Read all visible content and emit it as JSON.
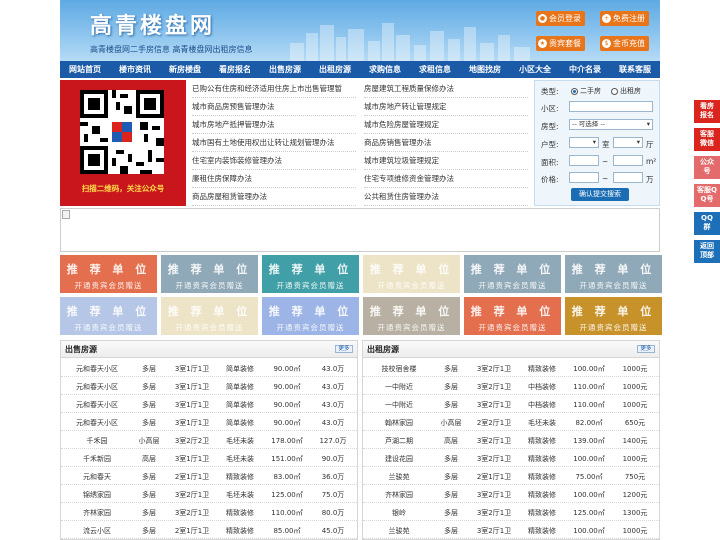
{
  "header": {
    "logo": "高青楼盘网",
    "tagline": "高青楼盘网二手房信息   高青楼盘网出租房信息",
    "buttons": [
      {
        "label": "会员登录",
        "icon": "user-icon"
      },
      {
        "label": "免费注册",
        "icon": "register-icon"
      },
      {
        "label": "贵宾套餐",
        "icon": "vip-icon"
      },
      {
        "label": "金币充值",
        "icon": "coin-icon"
      }
    ]
  },
  "nav": [
    "网站首页",
    "楼市资讯",
    "新房楼盘",
    "看房报名",
    "出售房源",
    "出租房源",
    "求购信息",
    "求租信息",
    "地图找房",
    "小区大全",
    "中介名录",
    "联系客服"
  ],
  "qr": {
    "caption": "扫描二维码，关注公众号"
  },
  "links_left": [
    "已购公有住房和经济适用住房上市出售管理暂",
    "城市商品房预售管理办法",
    "城市房地产抵押管理办法",
    "城市国有土地使用权出让转让规划管理办法",
    "住宅室内装饰装修管理办法",
    "廉租住房保障办法",
    "商品房屋租赁管理办法"
  ],
  "links_right": [
    "房屋建筑工程质量保修办法",
    "城市房地产转让管理规定",
    "城市危险房屋管理规定",
    "商品房销售管理办法",
    "城市建筑垃圾管理规定",
    "住宅专项维修资金管理办法",
    "公共租赁住房管理办法"
  ],
  "search": {
    "type_label": "类型:",
    "type_options": [
      "二手房",
      "出租房"
    ],
    "community_label": "小区:",
    "property_label": "房型:",
    "property_value": "-- 可选择 --",
    "layout_label": "户型:",
    "room_unit": "室",
    "hall_unit": "厅",
    "area_label": "面积:",
    "area_sep": "~",
    "area_unit": "m²",
    "price_label": "价格:",
    "price_sep": "~",
    "price_unit": "万",
    "submit": "确认提交搜索"
  },
  "tiles": {
    "line1": "推 荐 单 位",
    "line2": "开通贵宾会员赠送",
    "colors": [
      "#e46f4f",
      "#90a9b8",
      "#41a0a7",
      "#ede3c6",
      "#90a9b8",
      "#90a9b8",
      "#b5c6e6",
      "#ede3c6",
      "#9db4e6",
      "#b8b0a2",
      "#e46f4f",
      "#c8922b"
    ]
  },
  "sale": {
    "title": "出售房源",
    "more": "更多",
    "rows": [
      [
        "元和春天小区",
        "多层",
        "3室1厅1卫",
        "简单装修",
        "90.00㎡",
        "43.0万"
      ],
      [
        "元和春天小区",
        "多层",
        "3室1厅1卫",
        "简单装修",
        "90.00㎡",
        "43.0万"
      ],
      [
        "元和春天小区",
        "多层",
        "3室1厅1卫",
        "简单装修",
        "90.00㎡",
        "43.0万"
      ],
      [
        "元和春天小区",
        "多层",
        "3室1厅1卫",
        "简单装修",
        "90.00㎡",
        "43.0万"
      ],
      [
        "千禾园",
        "小高层",
        "3室2厅2卫",
        "毛坯未装",
        "178.00㎡",
        "127.0万"
      ],
      [
        "千禾新园",
        "高层",
        "3室1厅1卫",
        "毛坯未装",
        "151.00㎡",
        "90.0万"
      ],
      [
        "元和春天",
        "多层",
        "2室1厅1卫",
        "精致装修",
        "83.00㎡",
        "36.0万"
      ],
      [
        "锦绣家园",
        "多层",
        "3室2厅1卫",
        "毛坯未装",
        "125.00㎡",
        "75.0万"
      ],
      [
        "齐林家园",
        "多层",
        "3室2厅1卫",
        "精致装修",
        "110.00㎡",
        "80.0万"
      ],
      [
        "流云小区",
        "多层",
        "2室1厅1卫",
        "精致装修",
        "85.00㎡",
        "45.0万"
      ]
    ]
  },
  "rent": {
    "title": "出租房源",
    "more": "更多",
    "rows": [
      [
        "技校宿舍楼",
        "多层",
        "3室2厅1卫",
        "精致装修",
        "100.00㎡",
        "1000元"
      ],
      [
        "一中附近",
        "多层",
        "3室2厅1卫",
        "中档装修",
        "110.00㎡",
        "1000元"
      ],
      [
        "一中附近",
        "多层",
        "3室2厅1卫",
        "中档装修",
        "110.00㎡",
        "1000元"
      ],
      [
        "翰林家园",
        "小高层",
        "2室2厅1卫",
        "毛坯未装",
        "82.00㎡",
        "650元"
      ],
      [
        "芦湖二期",
        "高层",
        "3室2厅1卫",
        "精致装修",
        "139.00㎡",
        "1400元"
      ],
      [
        "建设花园",
        "多层",
        "3室2厅1卫",
        "精致装修",
        "100.00㎡",
        "1000元"
      ],
      [
        "兰骏苑",
        "多层",
        "2室1厅1卫",
        "精致装修",
        "75.00㎡",
        "750元"
      ],
      [
        "齐林家园",
        "多层",
        "3室2厅1卫",
        "精致装修",
        "100.00㎡",
        "1200元"
      ],
      [
        "银岭",
        "多层",
        "3室2厅1卫",
        "精致装修",
        "125.00㎡",
        "1300元"
      ],
      [
        "兰骏苑",
        "多层",
        "3室2厅1卫",
        "精致装修",
        "100.00㎡",
        "1000元"
      ]
    ]
  },
  "float": [
    {
      "label": "看房报名",
      "color": "#d9251d"
    },
    {
      "label": "客服微信",
      "color": "#d9251d"
    },
    {
      "label": "公众号",
      "color": "#e36b6b"
    },
    {
      "label": "客服QQ号",
      "color": "#e36b6b"
    },
    {
      "label": "QQ群",
      "color": "#1d6fb8"
    },
    {
      "label": "返回顶部",
      "color": "#1d6fb8"
    }
  ]
}
